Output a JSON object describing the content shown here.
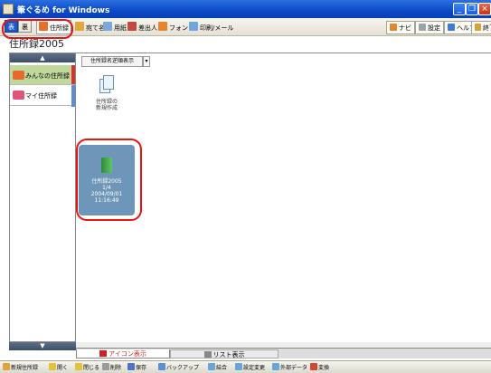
{
  "window": {
    "title": "筆ぐるめ for Windows"
  },
  "toolbar": {
    "front": "表",
    "back": "裏",
    "addressbook": "住所録",
    "recipient": "宛て名",
    "paper": "用紙",
    "import_export": "差出人",
    "font": "フォント",
    "print_mail": "印刷/メール",
    "navi": "ナビ",
    "settings": "設定",
    "help": "ヘルプ",
    "exit": "終了"
  },
  "page_title": "住所録2005",
  "sidebar": {
    "items": [
      {
        "label": "みんなの住所録"
      },
      {
        "label": "マイ住所録"
      }
    ]
  },
  "main": {
    "sort_label": "住所録名逆順表示",
    "new_card": {
      "line1": "住所録の",
      "line2": "新規作成"
    },
    "book_card": {
      "name": "住所録2005",
      "count": "1/4",
      "date": "2004/09/01",
      "time": "11:16:49"
    }
  },
  "view_toggle": {
    "icon_label": "アイコン表示",
    "list_label": "リスト表示"
  },
  "statusbar": {
    "new_addressbook": "新規住所録",
    "open": "開く",
    "close": "閉じる",
    "delete": "削除",
    "save": "保存",
    "backup": "バックアップ",
    "merge": "結合",
    "setting_change": "設定変更",
    "external_data": "外部データ",
    "convert": "変換"
  },
  "colors": {
    "accent": "#0a49c8",
    "highlight": "#e11111",
    "selected_cat": "#c0d89c"
  }
}
